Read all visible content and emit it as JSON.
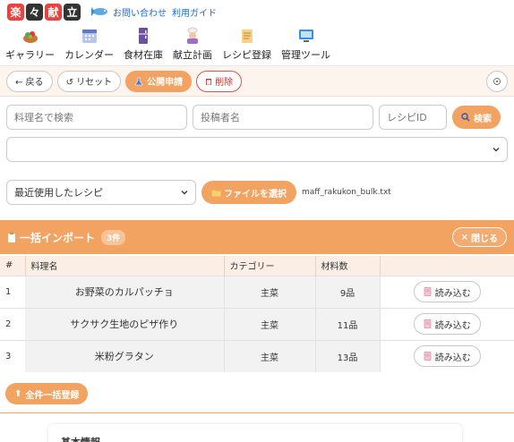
{
  "logo": [
    "楽",
    "々",
    "献",
    "立"
  ],
  "header_links": [
    "お問い合わせ",
    "利用ガイド"
  ],
  "nav": [
    {
      "label": "ギャラリー",
      "icon": "salad-icon"
    },
    {
      "label": "カレンダー",
      "icon": "calendar-icon"
    },
    {
      "label": "食材在庫",
      "icon": "fridge-icon"
    },
    {
      "label": "献立計画",
      "icon": "chef-icon"
    },
    {
      "label": "レシピ登録",
      "icon": "scroll-icon"
    },
    {
      "label": "管理ツール",
      "icon": "monitor-icon"
    }
  ],
  "toolbar": {
    "back": "← 戻る",
    "reset": "↺ リセット",
    "publish": "公開申請",
    "delete": "削除"
  },
  "search": {
    "recipe_name_placeholder": "料理名で検索",
    "author_placeholder": "投稿者名",
    "recipe_id_placeholder": "レシピID",
    "search_button": "検索"
  },
  "recent": {
    "selected": "最近使用したレシピ",
    "choose_file": "ファイルを選択",
    "filename": "maff_rakukon_bulk.txt"
  },
  "import": {
    "title": "一括インポート",
    "count": "3件",
    "close": "閉じる",
    "headers": [
      "#",
      "料理名",
      "カテゴリー",
      "材料数"
    ],
    "load_label": "読み込む",
    "rows": [
      {
        "no": "1",
        "name": "お野菜のカルパッチョ",
        "category": "主菜",
        "ingredients": "9品"
      },
      {
        "no": "2",
        "name": "サクサク生地のピザ作り",
        "category": "主菜",
        "ingredients": "11品"
      },
      {
        "no": "3",
        "name": "米粉グラタン",
        "category": "主菜",
        "ingredients": "13品"
      }
    ],
    "bulk_register": "全件一括登録"
  },
  "card": {
    "title": "基本情報"
  },
  "colors": {
    "accent": "#f2a261",
    "danger": "#c9302c",
    "link": "#1a6bd6"
  }
}
